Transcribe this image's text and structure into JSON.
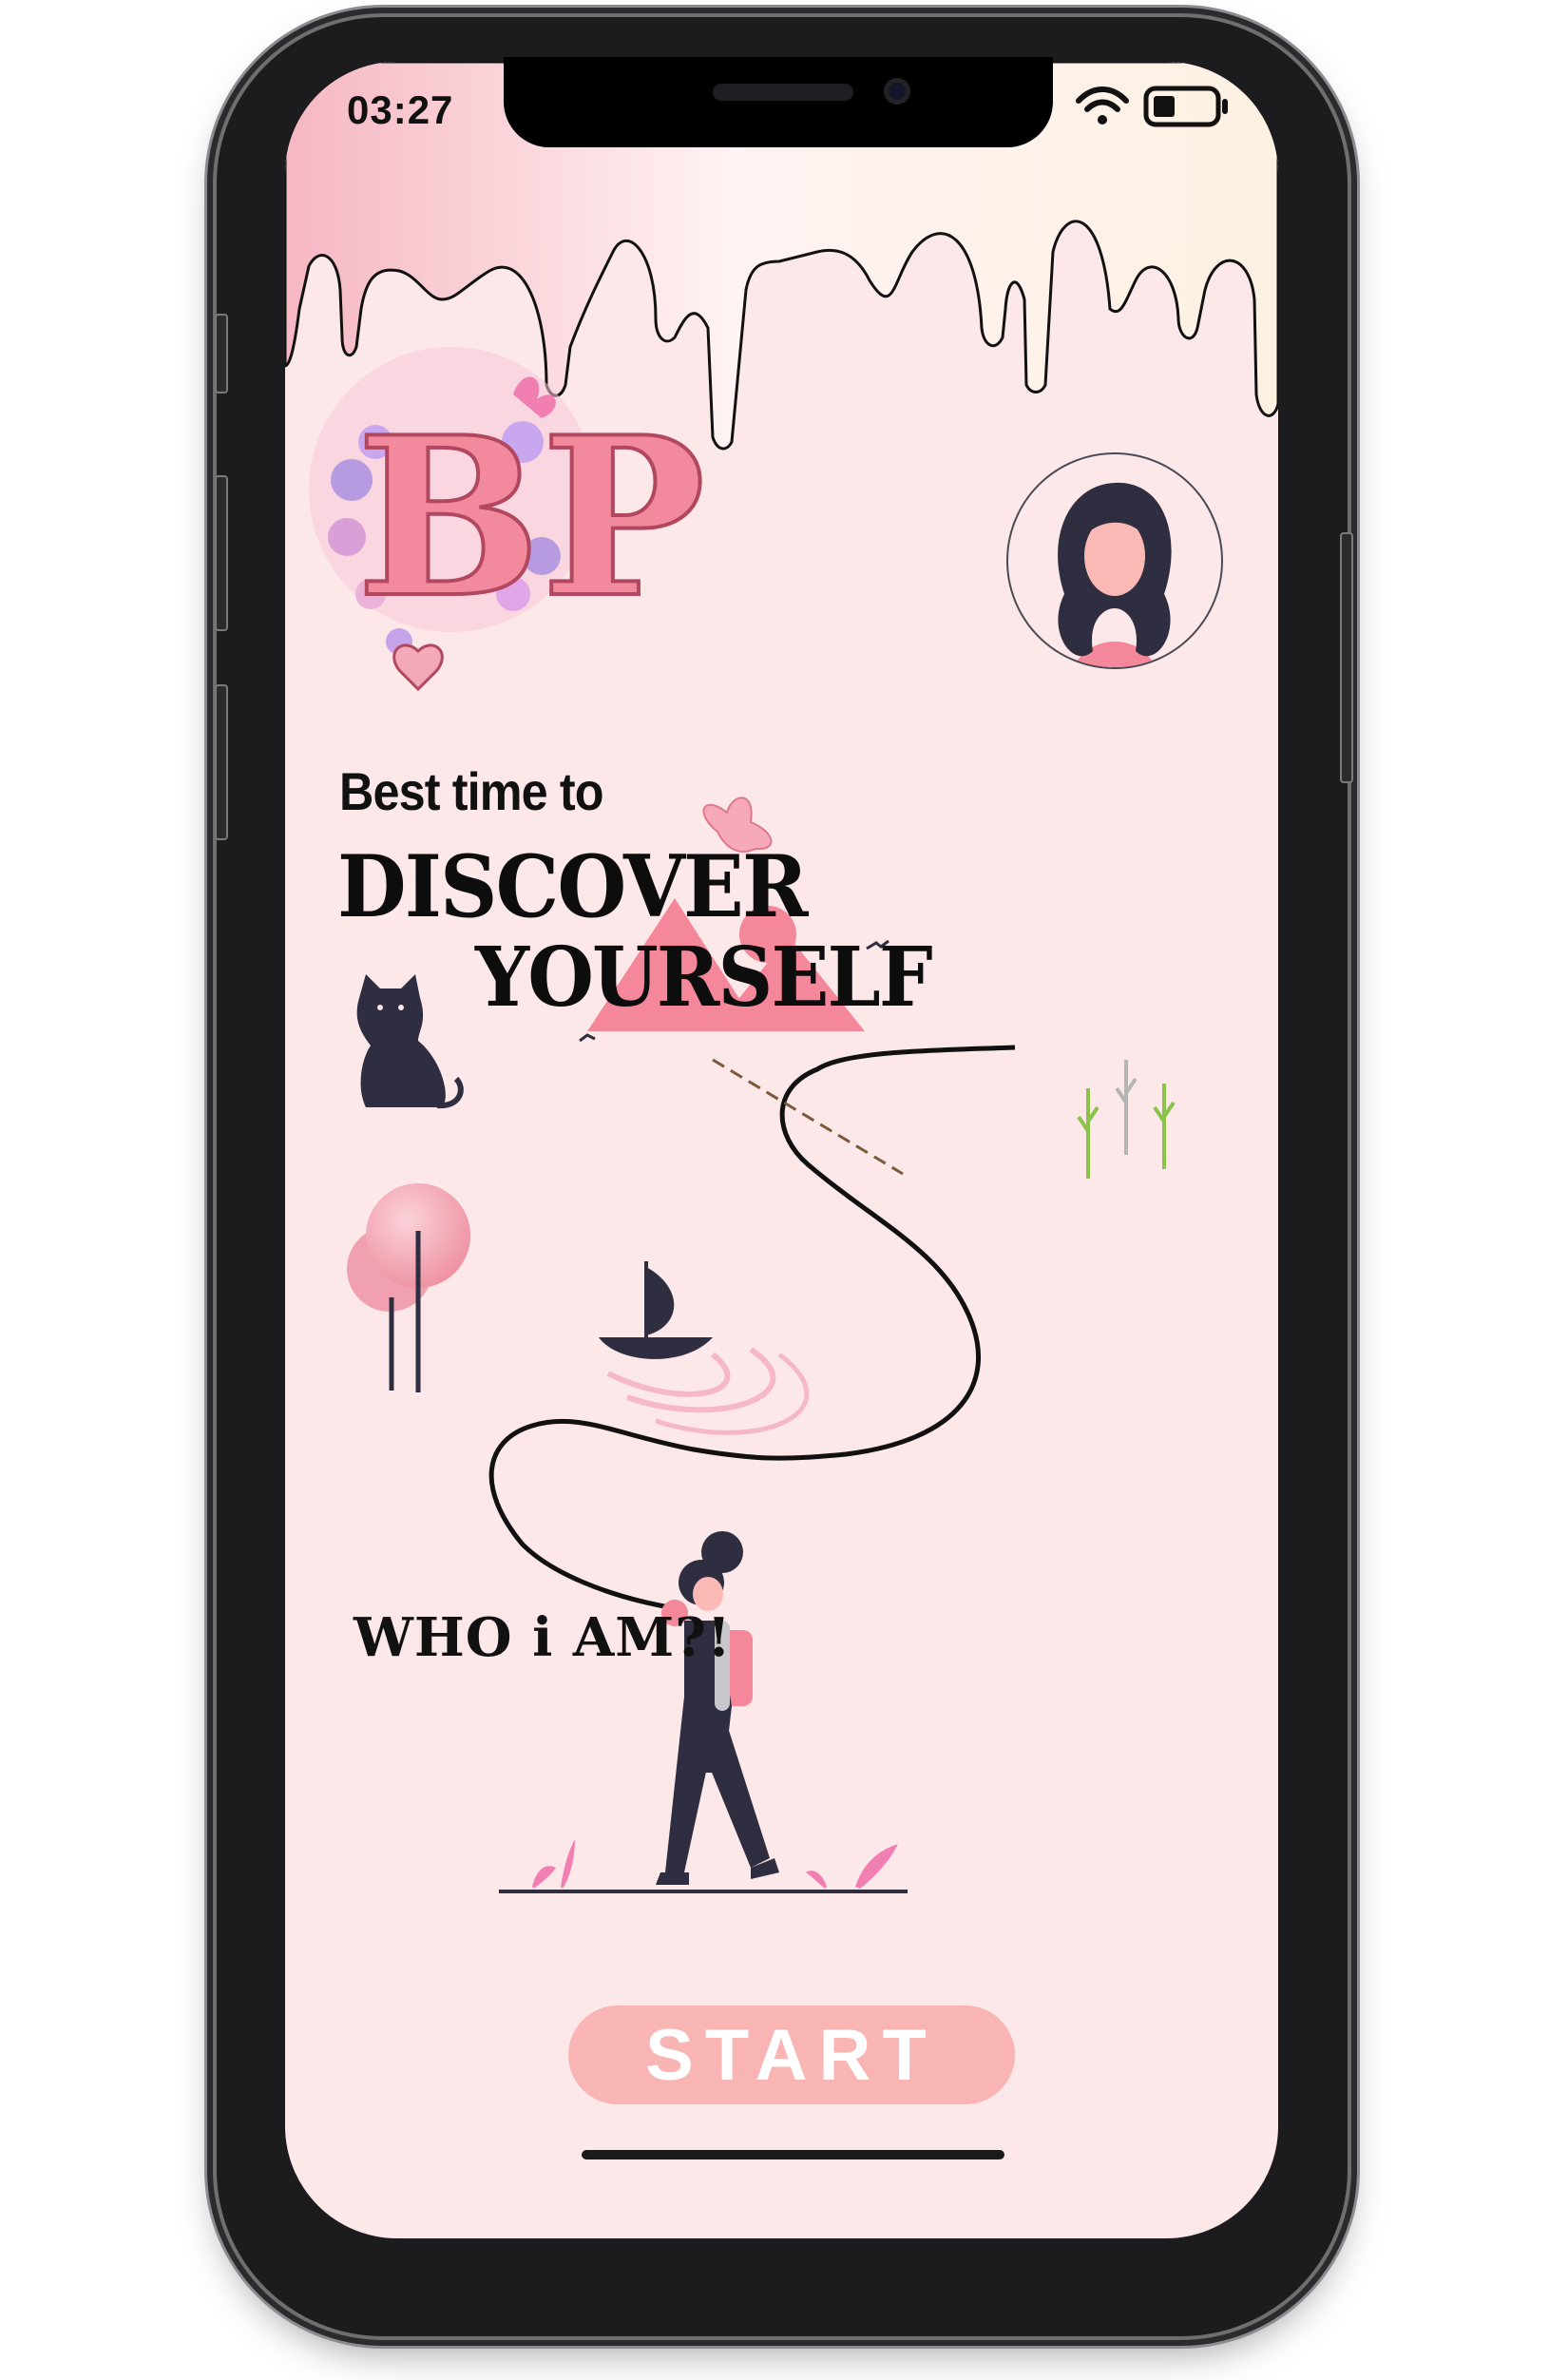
{
  "status_bar": {
    "time": "03:27",
    "icons": [
      "wifi-icon",
      "battery-icon"
    ]
  },
  "logo": {
    "text": "BP"
  },
  "headline": {
    "line1": "Best time to",
    "line2": "DISCOVER",
    "line3": "YOURSELF"
  },
  "path_label": "WHO i AM?!",
  "start_button": {
    "label": "START"
  },
  "colors": {
    "background": "#fde8e9",
    "accent_pink": "#f4879a",
    "button_pink": "#f9b5b4",
    "dark_navy": "#2f2e41"
  }
}
